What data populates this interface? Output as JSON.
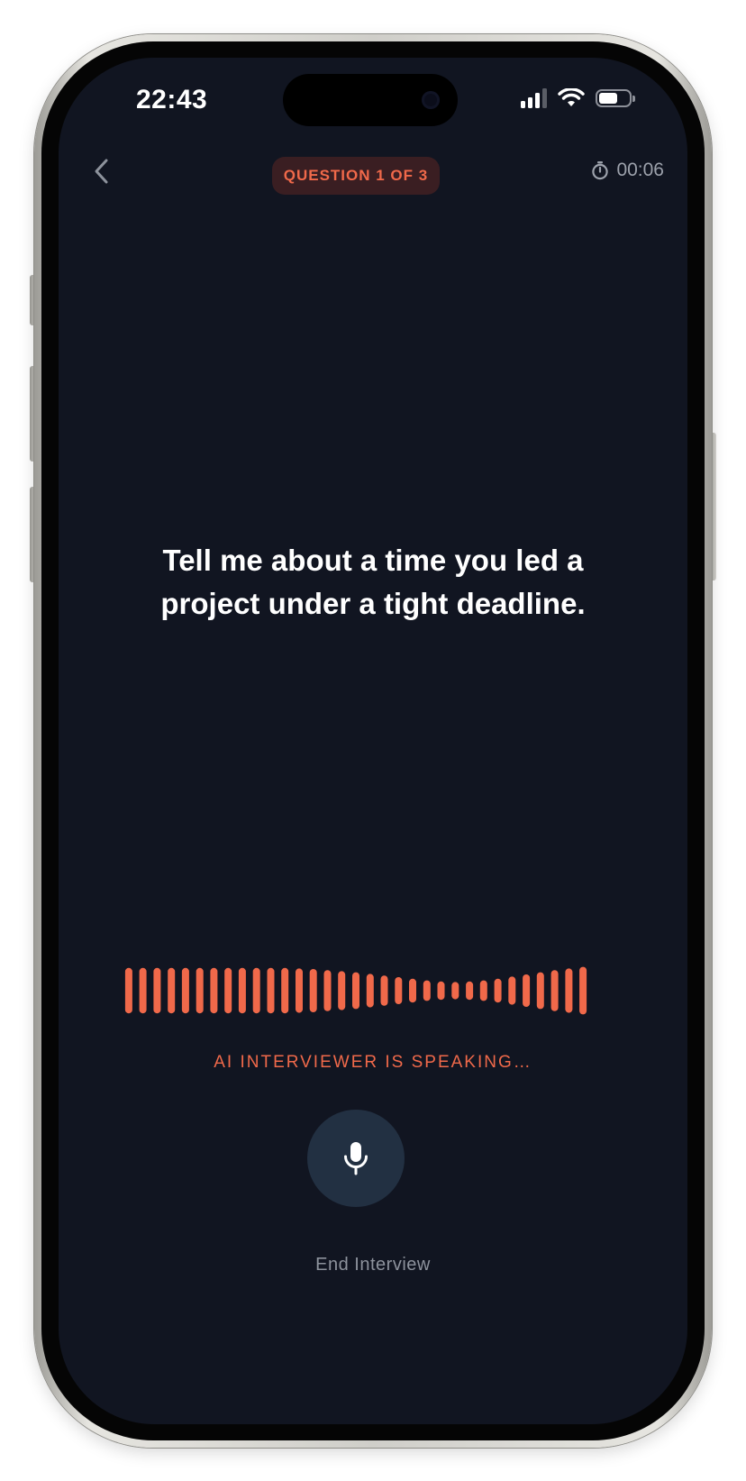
{
  "status_bar": {
    "time": "22:43",
    "signal_icon": "signal-bars-icon",
    "wifi_icon": "wifi-icon",
    "battery_icon": "battery-icon",
    "battery_level": 0.6
  },
  "header": {
    "back_icon": "chevron-left-icon",
    "question_badge": "QUESTION 1 OF 3",
    "timer_icon": "stopwatch-icon",
    "timer_value": "00:06"
  },
  "main": {
    "question_line1": "Tell me about a time you led a",
    "question_line2": "project under a tight deadline."
  },
  "voice": {
    "status_label": "AI INTERVIEWER IS SPEAKING…",
    "mic_icon": "microphone-icon",
    "end_label": "End Interview",
    "bar_levels": [
      0.84,
      0.84,
      0.84,
      0.84,
      0.84,
      0.84,
      0.84,
      0.84,
      0.84,
      0.84,
      0.84,
      0.84,
      0.82,
      0.8,
      0.76,
      0.72,
      0.68,
      0.62,
      0.56,
      0.5,
      0.44,
      0.38,
      0.34,
      0.32,
      0.34,
      0.38,
      0.44,
      0.52,
      0.6,
      0.68,
      0.76,
      0.82,
      0.88
    ]
  },
  "colors": {
    "background": "#111521",
    "accent": "#f0694a",
    "badge_bg": "#3a1e22",
    "mic_bg": "#223042",
    "muted_text": "#8d929c"
  }
}
